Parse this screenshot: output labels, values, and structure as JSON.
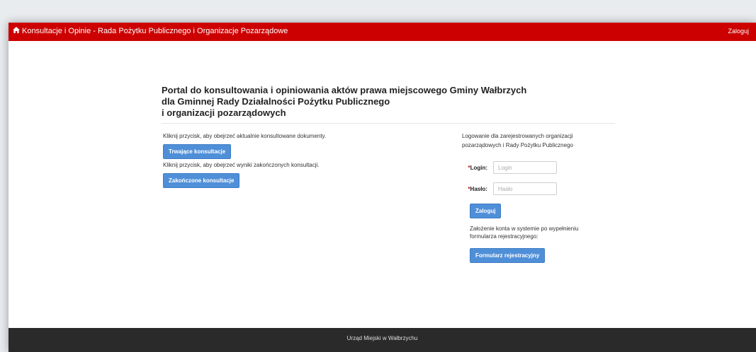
{
  "navbar": {
    "home_icon": "home-icon",
    "brand": "Konsultacje i Opinie - Rada Pożytku Publicznego i Organizacje Pozarządowe",
    "login": "Zaloguj",
    "color": "#cc0000"
  },
  "heading": {
    "line1": "Portal do konsultowania i opiniowania aktów prawa miejscowego Gminy Wałbrzych",
    "line2": "dla Gminnej Rady Działalności Pożytku Publicznego",
    "line3": "i organizacji pozarządowych"
  },
  "left": {
    "info_current": "Kliknij przycisk, aby obejrzeć aktualnie konsultowane dokumenty.",
    "btn_current": "Trwające konsultacje",
    "info_finished": "Kliknij przycisk, aby obejrzeć wyniki zakończonych konsultacji.",
    "btn_finished": "Zakończone konsultacje"
  },
  "login_form": {
    "intro": "Logowanie dla zarejestrowanych organizacji pozarządowych i Rady Pożytku Publicznego",
    "login_label": "Login:",
    "login_placeholder": "Login",
    "password_label": "Hasło:",
    "password_placeholder": "Hasło",
    "required_mark": "*",
    "submit": "Zaloguj",
    "register_info": "Założenie konta w systemie po wypełnieniu formularza rejestracyjnego:",
    "register_button": "Formularz rejestracyjny"
  },
  "footer": {
    "text": "Urząd Miejski w Wałbrzychu"
  }
}
